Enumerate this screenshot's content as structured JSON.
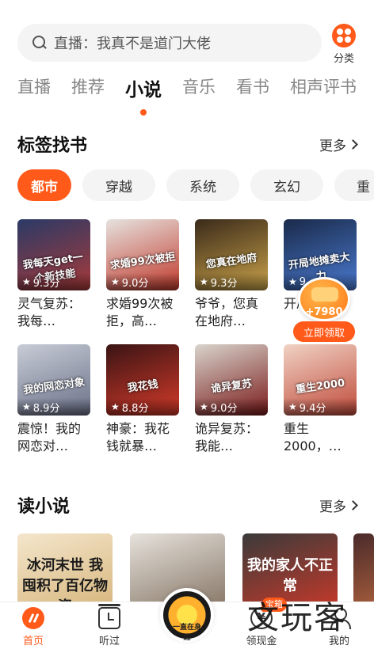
{
  "search": {
    "query": "直播：我真不是道门大佬"
  },
  "category": {
    "label": "分类"
  },
  "tabs": [
    {
      "label": "直播"
    },
    {
      "label": "推荐"
    },
    {
      "label": "小说"
    },
    {
      "label": "音乐"
    },
    {
      "label": "看书"
    },
    {
      "label": "相声评书"
    }
  ],
  "tag_section": {
    "title": "标签找书",
    "more": "更多",
    "chips": [
      "都市",
      "穿越",
      "系统",
      "玄幻",
      "重"
    ]
  },
  "books": [
    {
      "title": "灵气复苏：我每…",
      "cover_text": "我每天get一个新技能",
      "rating": "9.3分",
      "cover_colors": [
        "#2a3a66",
        "#a83a3a"
      ]
    },
    {
      "title": "求婚99次被拒，高…",
      "cover_text": "求婚99次被拒",
      "rating": "9.0分",
      "cover_colors": [
        "#e6e2de",
        "#c0392b"
      ]
    },
    {
      "title": "爷爷，您真在地府…",
      "cover_text": "您真在地府",
      "rating": "9.3分",
      "cover_colors": [
        "#3a2a1a",
        "#c9a24a"
      ]
    },
    {
      "title": "开局卖…",
      "cover_text": "开局地摊卖大力",
      "rating": "9.",
      "cover_colors": [
        "#1a2a4a",
        "#4a7ad0"
      ]
    },
    {
      "title": "震惊！我的网恋对…",
      "cover_text": "我的网恋对象",
      "rating": "8.9分",
      "cover_colors": [
        "#c8ccd6",
        "#6a7088"
      ]
    },
    {
      "title": "神豪：我花钱就暴…",
      "cover_text": "我花钱",
      "rating": "8.8分",
      "cover_colors": [
        "#3a1414",
        "#d43a2a"
      ]
    },
    {
      "title": "诡异复苏：我能…",
      "cover_text": "诡异复苏",
      "rating": "9.0分",
      "cover_colors": [
        "#d8d4cc",
        "#7a1a1a"
      ]
    },
    {
      "title": "重生2000，…",
      "cover_text": "重生2000",
      "rating": "9.4分",
      "cover_colors": [
        "#f0d2c4",
        "#c04a3a"
      ]
    }
  ],
  "promo": {
    "amount": "+7980",
    "button": "立即领取"
  },
  "read_section": {
    "title": "读小说",
    "more": "更多",
    "covers": [
      {
        "text": "冰河末世 我囤积了百亿物资",
        "colors": [
          "#f4e6cc",
          "#d8b880"
        ]
      },
      {
        "text": "",
        "colors": [
          "#e6e2dc",
          "#8a7a6a"
        ]
      },
      {
        "text": "我的家人不正常",
        "colors": [
          "#3a3a3a",
          "#c0392b"
        ]
      },
      {
        "text": "",
        "colors": [
          "#4a2a2a",
          "#a05a3a"
        ]
      }
    ]
  },
  "bottom_nav": {
    "items": [
      {
        "label": "首页"
      },
      {
        "label": "听过"
      },
      {
        "label": "领现金"
      },
      {
        "label": "我的"
      }
    ],
    "center_disc_text": "一直在身边",
    "badge": "宝箱"
  },
  "watermark": "文玩客",
  "colors": {
    "accent": "#ff5a1a"
  }
}
